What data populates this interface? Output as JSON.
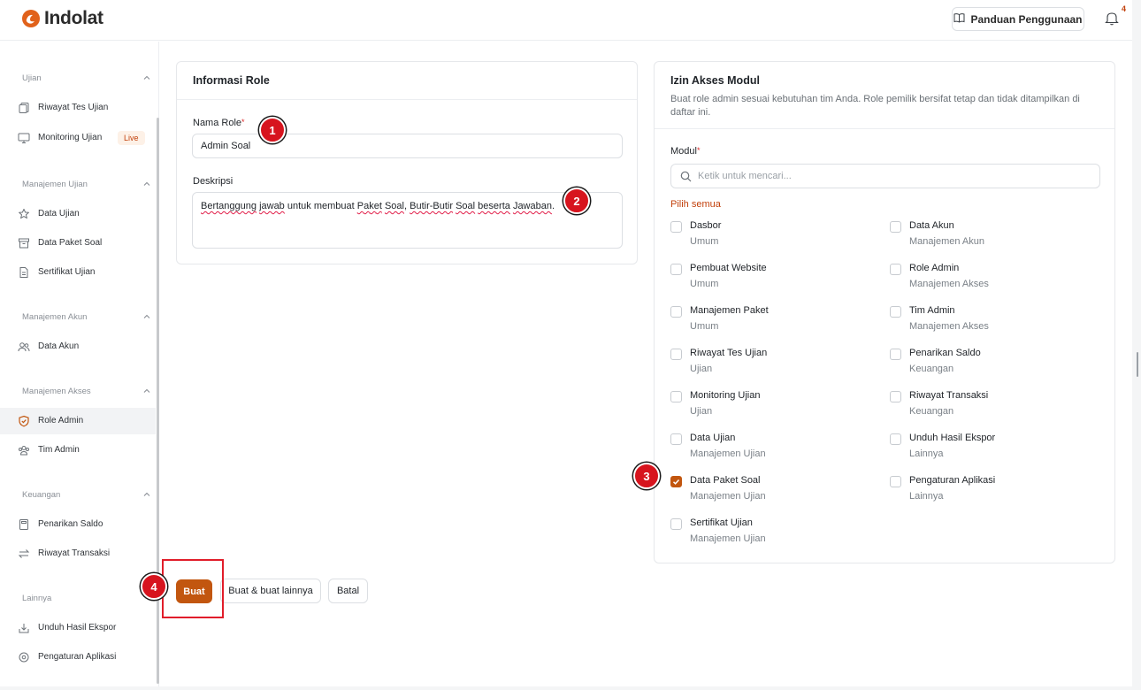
{
  "app": {
    "brand": "Indolat",
    "brand_color": "#e1621b",
    "accent_color": "#c2560f"
  },
  "header": {
    "guide_button": "Panduan Penggunaan",
    "guide_icon": "book-icon",
    "notification_icon": "bell-icon",
    "notification_count": "4"
  },
  "sidebar": {
    "sections": [
      {
        "label": "Ujian",
        "items": [
          {
            "label": "Riwayat Tes Ujian",
            "icon": "copy-icon"
          },
          {
            "label": "Monitoring Ujian",
            "icon": "monitor-icon",
            "badge": "Live"
          }
        ]
      },
      {
        "label": "Manajemen Ujian",
        "items": [
          {
            "label": "Data Ujian",
            "icon": "star-icon"
          },
          {
            "label": "Data Paket Soal",
            "icon": "archive-icon"
          },
          {
            "label": "Sertifikat Ujian",
            "icon": "file-icon"
          }
        ]
      },
      {
        "label": "Manajemen Akun",
        "items": [
          {
            "label": "Data Akun",
            "icon": "users-icon"
          }
        ]
      },
      {
        "label": "Manajemen Akses",
        "items": [
          {
            "label": "Role Admin",
            "icon": "shield-check-icon",
            "active": true
          },
          {
            "label": "Tim Admin",
            "icon": "team-icon"
          }
        ]
      },
      {
        "label": "Keuangan",
        "items": [
          {
            "label": "Penarikan Saldo",
            "icon": "calculator-icon"
          },
          {
            "label": "Riwayat Transaksi",
            "icon": "transfer-icon"
          }
        ]
      },
      {
        "label": "Lainnya",
        "items": [
          {
            "label": "Unduh Hasil Ekspor",
            "icon": "download-icon"
          },
          {
            "label": "Pengaturan Aplikasi",
            "icon": "settings-icon"
          }
        ]
      }
    ]
  },
  "role_info": {
    "title": "Informasi Role",
    "name_label": "Nama Role",
    "required_mark": "*",
    "name_value": "Admin Soal",
    "description_label": "Deskripsi",
    "description_words": [
      "Bertanggung",
      " ",
      "jawab",
      " untuk membuat ",
      "Paket",
      " ",
      "Soal",
      ", ",
      "Butir-Butir",
      " ",
      "Soal",
      " ",
      "beserta",
      " ",
      "Jawaban",
      "."
    ]
  },
  "module_access": {
    "title": "Izin Akses Modul",
    "description": "Buat role admin sesuai kebutuhan tim Anda. Role pemilik bersifat tetap dan tidak ditampilkan di daftar ini.",
    "module_label": "Modul",
    "search_placeholder": "Ketik untuk mencari...",
    "select_all": "Pilih semua",
    "left_column": [
      {
        "name": "Dasbor",
        "category": "Umum",
        "checked": false
      },
      {
        "name": "Pembuat Website",
        "category": "Umum",
        "checked": false
      },
      {
        "name": "Manajemen Paket",
        "category": "Umum",
        "checked": false
      },
      {
        "name": "Riwayat Tes Ujian",
        "category": "Ujian",
        "checked": false
      },
      {
        "name": "Monitoring Ujian",
        "category": "Ujian",
        "checked": false
      },
      {
        "name": "Data Ujian",
        "category": "Manajemen Ujian",
        "checked": false
      },
      {
        "name": "Data Paket Soal",
        "category": "Manajemen Ujian",
        "checked": true
      },
      {
        "name": "Sertifikat Ujian",
        "category": "Manajemen Ujian",
        "checked": false
      }
    ],
    "right_column": [
      {
        "name": "Data Akun",
        "category": "Manajemen Akun",
        "checked": false
      },
      {
        "name": "Role Admin",
        "category": "Manajemen Akses",
        "checked": false
      },
      {
        "name": "Tim Admin",
        "category": "Manajemen Akses",
        "checked": false
      },
      {
        "name": "Penarikan Saldo",
        "category": "Keuangan",
        "checked": false
      },
      {
        "name": "Riwayat Transaksi",
        "category": "Keuangan",
        "checked": false
      },
      {
        "name": "Unduh Hasil Ekspor",
        "category": "Lainnya",
        "checked": false
      },
      {
        "name": "Pengaturan Aplikasi",
        "category": "Lainnya",
        "checked": false
      }
    ]
  },
  "actions": {
    "create": "Buat",
    "create_another": "Buat & buat lainnya",
    "cancel": "Batal"
  },
  "step_markers": [
    "1",
    "2",
    "3",
    "4"
  ]
}
